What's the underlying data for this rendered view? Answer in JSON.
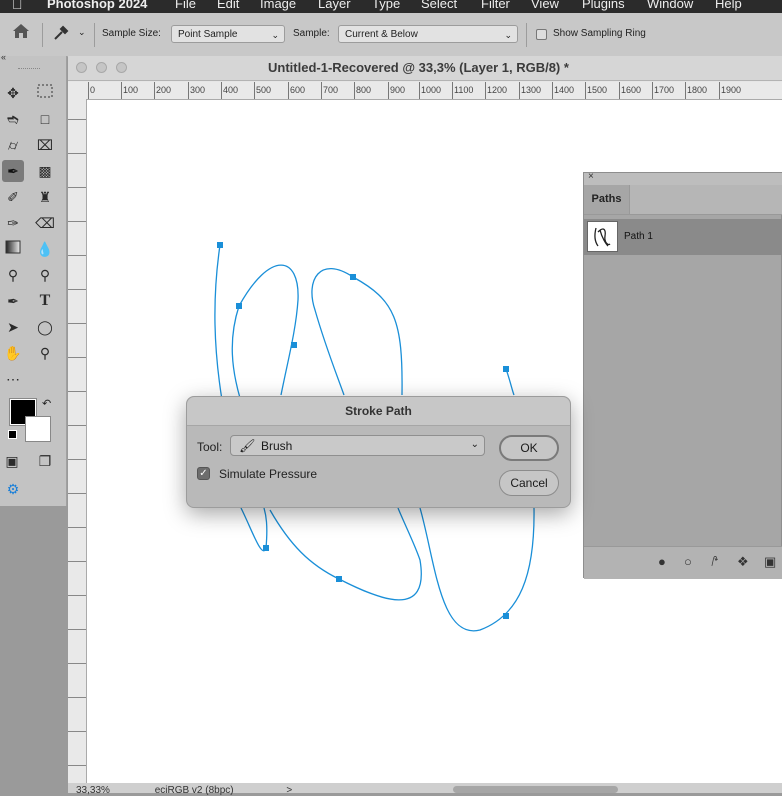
{
  "menubar": {
    "app_name": "Photoshop 2024",
    "items": [
      "File",
      "Edit",
      "Image",
      "Layer",
      "Type",
      "Select",
      "Filter",
      "View",
      "Plugins",
      "Window",
      "Help"
    ]
  },
  "options_bar": {
    "sample_size_label": "Sample Size:",
    "sample_size_value": "Point Sample",
    "sample_label": "Sample:",
    "sample_value": "Current & Below",
    "show_sampling_ring": "Show Sampling Ring"
  },
  "document": {
    "title": "Untitled-1-Recovered @ 33,3% (Layer 1, RGB/8) *",
    "ruler_labels": [
      "0",
      "100",
      "200",
      "300",
      "400",
      "500",
      "600",
      "700",
      "800",
      "900",
      "1000",
      "1100",
      "1200",
      "1300",
      "1400",
      "1500",
      "1600",
      "1700",
      "1800",
      "1900"
    ],
    "status_zoom": "33,33%",
    "status_profile": "eciRGB v2 (8bpc)",
    "status_arrow": ">"
  },
  "paths_panel": {
    "tab": "Paths",
    "close": "×",
    "rows": [
      {
        "name": "Path 1"
      }
    ]
  },
  "dialog": {
    "title": "Stroke Path",
    "tool_label": "Tool:",
    "tool_value": "Brush",
    "simulate_pressure": "Simulate Pressure",
    "ok": "OK",
    "cancel": "Cancel"
  },
  "colors": {
    "path_stroke": "#1a8fd8",
    "foreground": "#000000",
    "background": "#ffffff"
  }
}
